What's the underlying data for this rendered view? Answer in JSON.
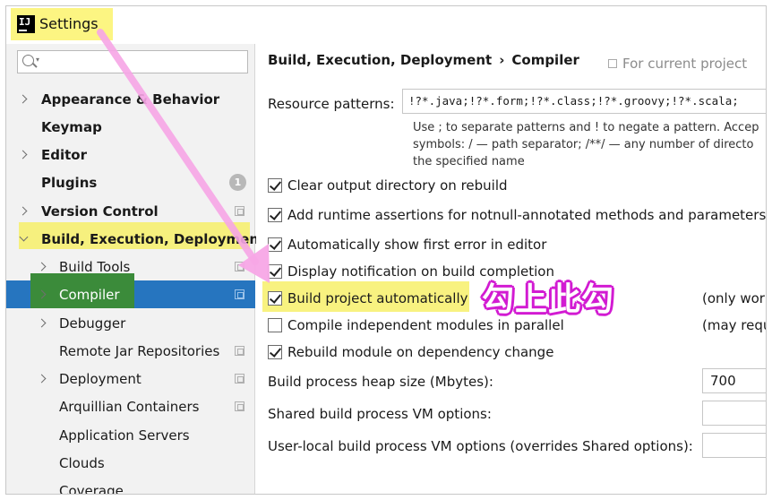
{
  "window": {
    "title": "Settings",
    "icon": "intellij-icon"
  },
  "search": {
    "placeholder": "",
    "value": ""
  },
  "sidebar": {
    "items": [
      {
        "label": "Appearance & Behavior",
        "bold": true,
        "arrow": "right"
      },
      {
        "label": "Keymap",
        "bold": true
      },
      {
        "label": "Editor",
        "bold": true,
        "arrow": "right"
      },
      {
        "label": "Plugins",
        "bold": true,
        "badge": "1"
      },
      {
        "label": "Version Control",
        "bold": true,
        "arrow": "right",
        "icon": "copy-icon"
      },
      {
        "label": "Build, Execution, Deployment",
        "bold": true,
        "arrow": "down",
        "highlight": "yellow"
      },
      {
        "label": "Build Tools",
        "arrow": "right",
        "icon": "copy-icon"
      },
      {
        "label": "Compiler",
        "arrow": "right",
        "selected": true,
        "icon": "copy-icon",
        "highlight": "green"
      },
      {
        "label": "Debugger",
        "arrow": "right"
      },
      {
        "label": "Remote Jar Repositories",
        "icon": "copy-icon"
      },
      {
        "label": "Deployment",
        "arrow": "right",
        "icon": "copy-icon"
      },
      {
        "label": "Arquillian Containers",
        "icon": "copy-icon"
      },
      {
        "label": "Application Servers"
      },
      {
        "label": "Clouds"
      },
      {
        "label": "Coverage"
      }
    ]
  },
  "main": {
    "breadcrumb": {
      "parent": "Build, Execution, Deployment",
      "separator": "›",
      "current": "Compiler"
    },
    "for_current_project": "For current project",
    "resource_patterns": {
      "label": "Resource patterns:",
      "value": "!?*.java;!?*.form;!?*.class;!?*.groovy;!?*.scala;",
      "hint_lines": [
        "Use ; to separate patterns and ! to negate a pattern. Accep",
        "symbols: / — path separator; /**/ — any number of directo",
        "the specified name"
      ]
    },
    "checkboxes": [
      {
        "label": "Clear output directory on rebuild",
        "checked": true
      },
      {
        "label": "Add runtime assertions for notnull-annotated methods and parameters",
        "checked": true
      },
      {
        "label": "Automatically show first error in editor",
        "checked": true
      },
      {
        "label": "Display notification on build completion",
        "checked": true
      },
      {
        "label": "Build project automatically",
        "checked": true,
        "note": "(only work",
        "highlight": "yellow"
      },
      {
        "label": "Compile independent modules in parallel",
        "checked": false,
        "note": "(may requ"
      },
      {
        "label": "Rebuild module on dependency change",
        "checked": true
      }
    ],
    "heap_size": {
      "label": "Build process heap size (Mbytes):",
      "value": "700"
    },
    "shared_vm": {
      "label": "Shared build process VM options:",
      "value": ""
    },
    "user_vm": {
      "label": "User-local build process VM options (overrides Shared options):",
      "value": ""
    }
  },
  "annotation": {
    "text": "勾上此勾",
    "color": "#d21bd2"
  }
}
